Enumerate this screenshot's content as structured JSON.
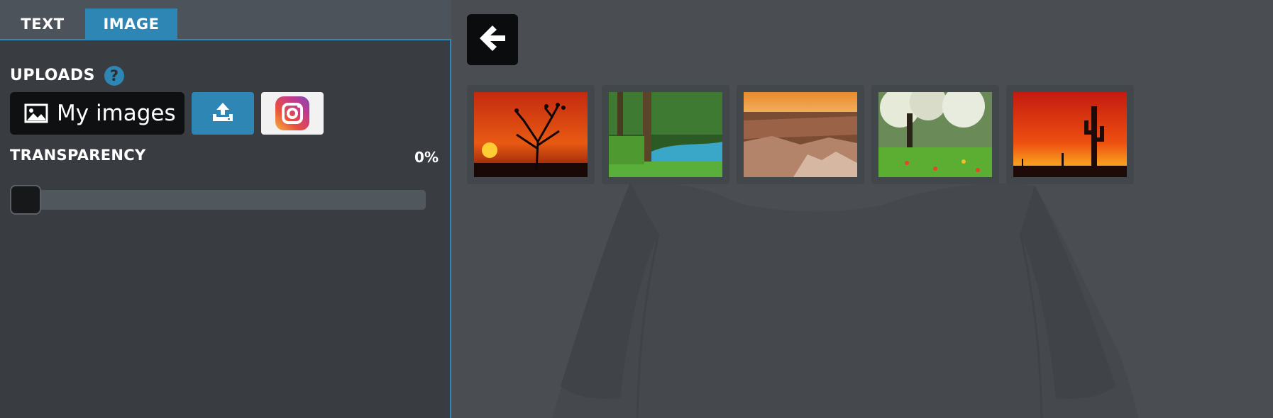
{
  "tabs": [
    {
      "label": "TEXT",
      "active": false
    },
    {
      "label": "IMAGE",
      "active": true
    }
  ],
  "uploads": {
    "label": "UPLOADS",
    "help_symbol": "?",
    "my_images_label": "My images",
    "upload_icon": "upload-icon",
    "instagram_icon": "instagram-icon"
  },
  "transparency": {
    "label": "TRANSPARENCY",
    "value_text": "0%",
    "value": 0
  },
  "gallery": {
    "back_icon": "arrow-left-icon",
    "images": [
      {
        "name": "sunset-tree-with-birds"
      },
      {
        "name": "forest-river"
      },
      {
        "name": "canyon-landscape"
      },
      {
        "name": "blossom-tree-meadow"
      },
      {
        "name": "desert-sunset-cactus"
      }
    ]
  },
  "colors": {
    "accent": "#2e86b5",
    "panel": "#393c40",
    "stage": "#4a4d51"
  }
}
